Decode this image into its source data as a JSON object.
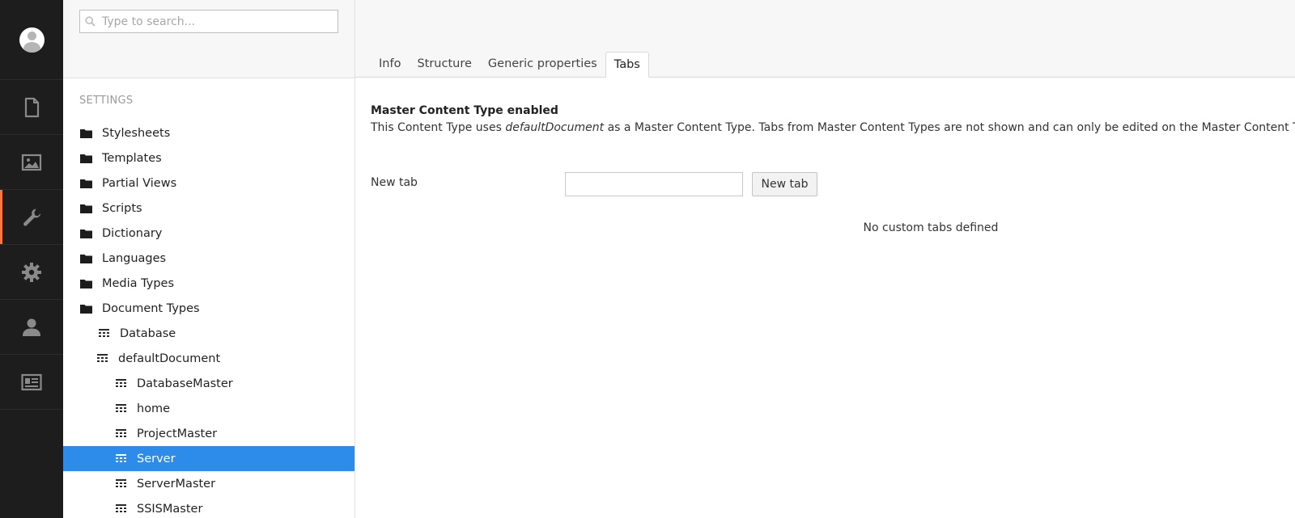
{
  "rail": {
    "items": [
      {
        "name": "content",
        "icon": "document-icon",
        "active": false
      },
      {
        "name": "media",
        "icon": "image-icon",
        "active": false
      },
      {
        "name": "settings",
        "icon": "wrench-icon",
        "active": true
      },
      {
        "name": "developer",
        "icon": "gear-icon",
        "active": false
      },
      {
        "name": "users",
        "icon": "user-icon",
        "active": false
      },
      {
        "name": "members",
        "icon": "id-card-icon",
        "active": false
      }
    ],
    "accent": "#f5783c"
  },
  "tree": {
    "search_placeholder": "Type to search...",
    "section_title": "SETTINGS",
    "items": [
      {
        "label": "Stylesheets",
        "icon": "folder-icon"
      },
      {
        "label": "Templates",
        "icon": "folder-icon"
      },
      {
        "label": "Partial Views",
        "icon": "folder-icon"
      },
      {
        "label": "Scripts",
        "icon": "folder-icon"
      },
      {
        "label": "Dictionary",
        "icon": "folder-icon"
      },
      {
        "label": "Languages",
        "icon": "folder-icon"
      },
      {
        "label": "Media Types",
        "icon": "folder-icon"
      },
      {
        "label": "Document Types",
        "icon": "folder-icon"
      },
      {
        "label": "Database",
        "icon": "doctype-icon"
      },
      {
        "label": "defaultDocument",
        "icon": "doctype-icon"
      },
      {
        "label": "DatabaseMaster",
        "icon": "doctype-icon"
      },
      {
        "label": "home",
        "icon": "doctype-icon"
      },
      {
        "label": "ProjectMaster",
        "icon": "doctype-icon"
      },
      {
        "label": "Server",
        "icon": "doctype-icon",
        "selected": true
      },
      {
        "label": "ServerMaster",
        "icon": "doctype-icon"
      },
      {
        "label": "SSISMaster",
        "icon": "doctype-icon"
      }
    ],
    "selected_color": "#2d8cea"
  },
  "main": {
    "tabs": [
      {
        "label": "Info",
        "active": false
      },
      {
        "label": "Structure",
        "active": false
      },
      {
        "label": "Generic properties",
        "active": false
      },
      {
        "label": "Tabs",
        "active": true
      }
    ],
    "notice": {
      "title": "Master Content Type enabled",
      "text_before": "This Content Type uses ",
      "text_em": "defaultDocument",
      "text_after": " as a Master Content Type. Tabs from Master Content Types are not shown and can only be edited on the Master Content Type itself"
    },
    "new_tab": {
      "label": "New tab",
      "input_value": "",
      "button_label": "New tab"
    },
    "empty_message": "No custom tabs defined"
  }
}
